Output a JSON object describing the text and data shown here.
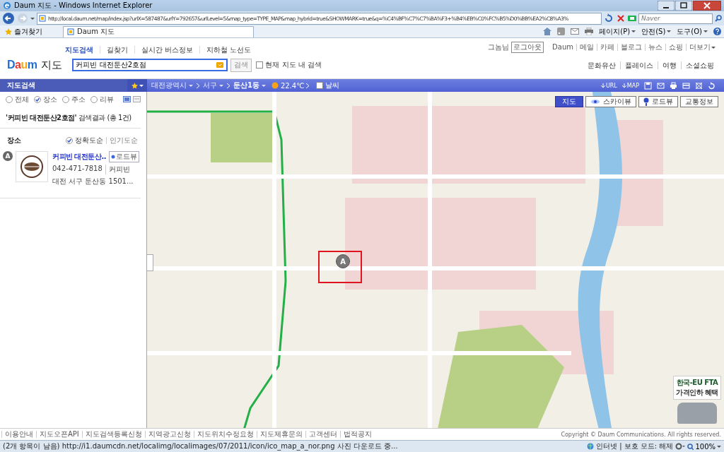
{
  "browser": {
    "title": "Daum 지도 - Windows Internet Explorer",
    "address": "http://local.daum.net/map/index.jsp?urlX=587487&urlY=792657&urlLevel=5&map_type=TYPE_MAP&map_hybrid=true&SHOWMARK=true&q=%C4%BF%C7%C7%BA%F3+%B4%EB%C0%FC%B5%D0%BB%EA2%C8%A3%",
    "search_placeholder": "Naver",
    "favorites": "즐겨찾기",
    "tabs": [
      {
        "label": "Daum 지도",
        "selected": true
      }
    ],
    "tools": [
      "페이지(P)",
      "안전(S)",
      "도구(O)"
    ]
  },
  "header": {
    "nav": [
      {
        "label": "지도검색",
        "selected": true
      },
      {
        "label": "길찾기",
        "selected": false
      },
      {
        "label": "실시간 버스정보",
        "selected": false
      },
      {
        "label": "지하철 노선도",
        "selected": false
      }
    ],
    "logo": "Daum",
    "logo_title": "지도",
    "search": {
      "value": "커피빈 대전둔산2호점"
    },
    "search_button": "검색",
    "in_map": {
      "label": "현재 지도 내 검색",
      "checked": false
    },
    "user": "그놈님",
    "logout": "로그아웃",
    "top_links": [
      "Daum",
      "메일",
      "카페",
      "블로그",
      "뉴스",
      "쇼핑",
      "더보기"
    ],
    "service_links": [
      "문화유산",
      "플레이스",
      "여행",
      "소셜쇼핑"
    ]
  },
  "toolbar": {
    "title": "지도검색",
    "breadcrumb": [
      "대전광역시",
      "서구",
      "둔산1동"
    ],
    "temperature": "22.4℃",
    "weather": {
      "label": "날씨",
      "checked": false
    },
    "actions": [
      "URL",
      "MAP"
    ]
  },
  "sidebar": {
    "filters": [
      {
        "label": "전체",
        "selected": false
      },
      {
        "label": "장소",
        "selected": true
      },
      {
        "label": "주소",
        "selected": false
      },
      {
        "label": "리뷰",
        "selected": false
      }
    ],
    "summary": "**'커피빈 대전둔산2호점'** 검색결과 (총 1건)",
    "section": "장소",
    "sorts": [
      {
        "label": "정확도순",
        "selected": true
      },
      {
        "label": "인기도순",
        "selected": false
      }
    ],
    "results": [
      {
        "marker": "A",
        "name": "커피빈 대전둔산..",
        "roadview": "로드뷰",
        "phone": "042-471-7818",
        "category": "커피빈",
        "address": "대전 서구 둔산동 1501..."
      }
    ]
  },
  "map": {
    "types": [
      {
        "label": "지도",
        "selected": true
      },
      {
        "label": "스카이뷰",
        "selected": false
      },
      {
        "label": "로드뷰",
        "selected": false
      },
      {
        "label": "교통정보",
        "selected": false
      }
    ],
    "marker": "A",
    "ad": [
      "한국-EU FTA",
      "가격인하 혜택"
    ]
  },
  "footer": {
    "links": [
      "이용안내",
      "지도오픈API",
      "지도검색등록신청",
      "지역광고신청",
      "지도위치수정요청",
      "지도제휴문의",
      "고객센터",
      "법적공지"
    ],
    "copyright": "Copyright © Daum Communications. All rights reserved."
  },
  "status": {
    "text": "(2개 항목이 남음) http://i1.daumcdn.net/localimg/localimages/07/2011/icon/ico_map_a_nor.png 사진 다운로드 중...",
    "zone": "인터넷 | 보호 모드: 해제",
    "zoom": "100%"
  }
}
